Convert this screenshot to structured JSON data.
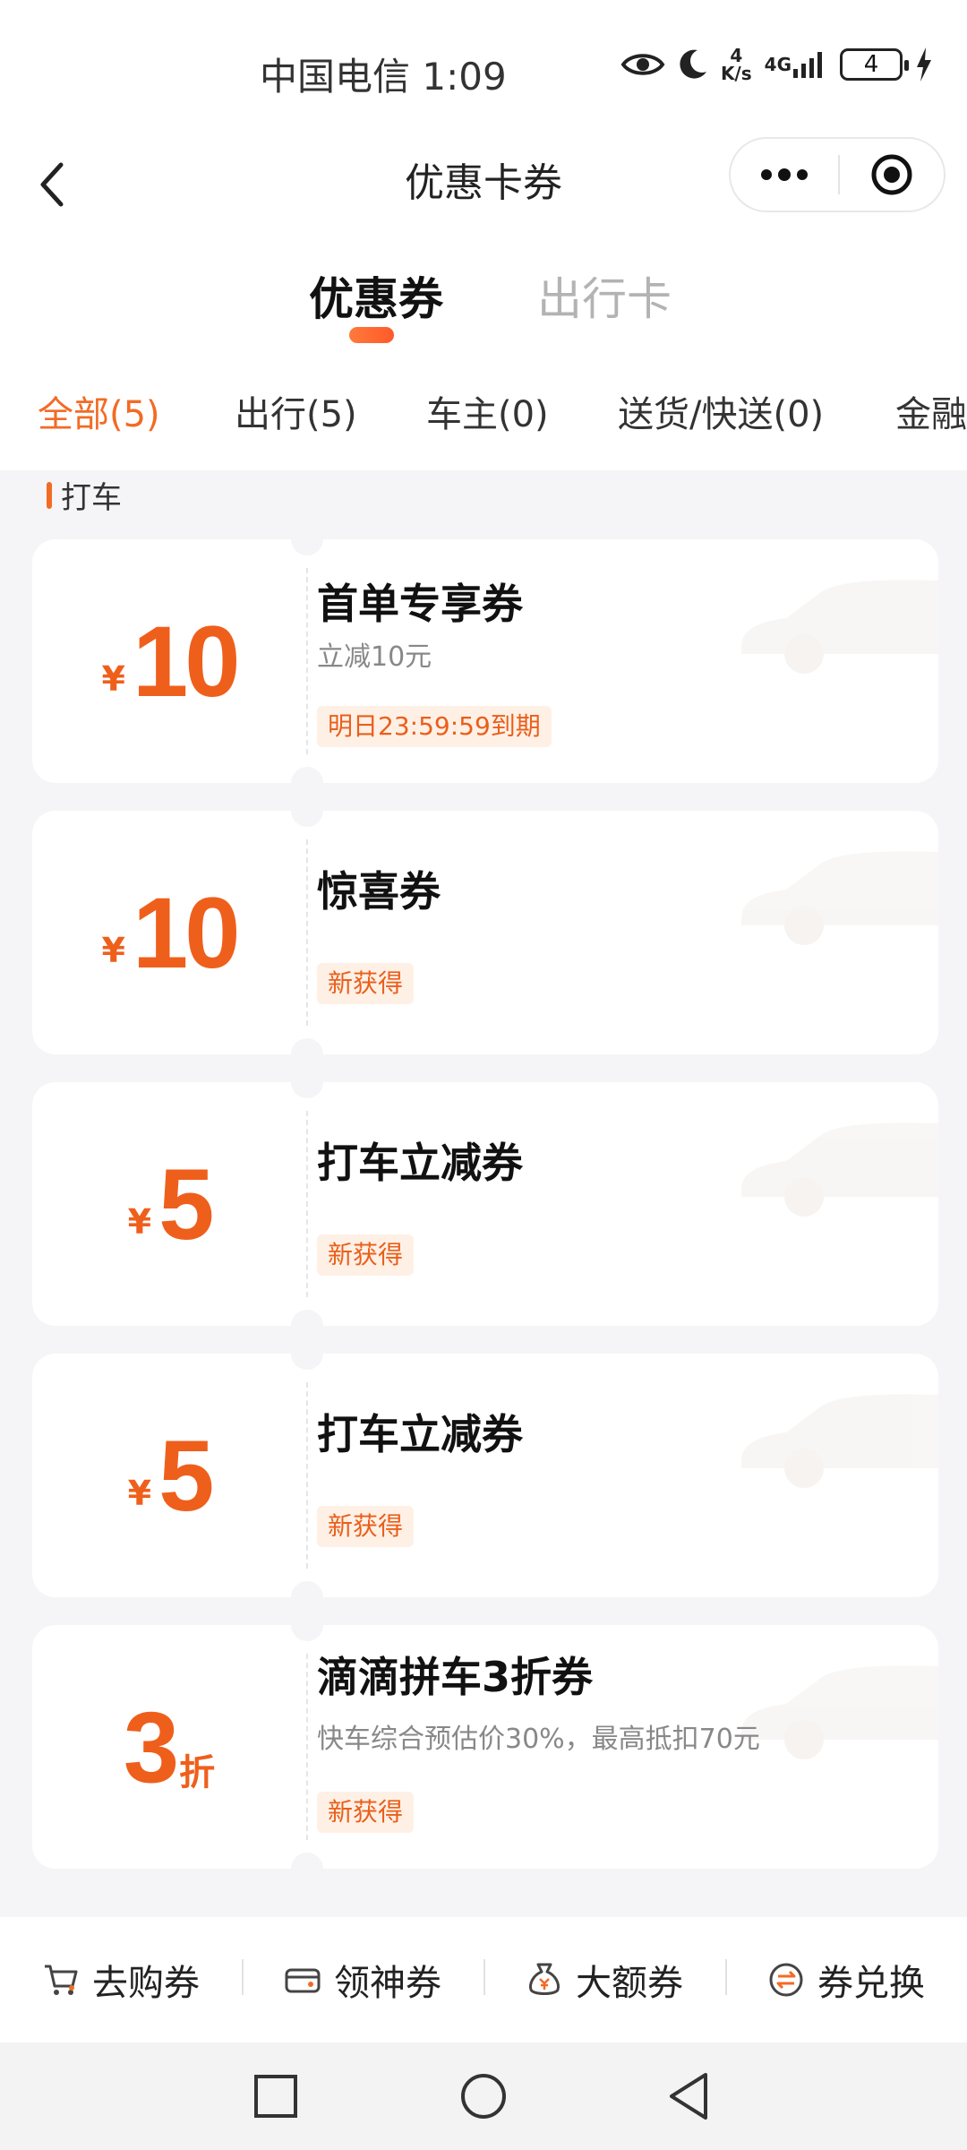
{
  "status_bar": {
    "carrier_time": "中国电信 1:09",
    "net_speed_value": "4",
    "net_speed_unit": "K/s",
    "network": "4G",
    "battery": "4"
  },
  "header": {
    "title": "优惠卡券"
  },
  "main_tabs": [
    {
      "label": "优惠券",
      "active": true
    },
    {
      "label": "出行卡",
      "active": false
    }
  ],
  "sub_tabs": [
    {
      "label": "全部(5)",
      "active": true
    },
    {
      "label": "出行(5)",
      "active": false
    },
    {
      "label": "车主(0)",
      "active": false
    },
    {
      "label": "送货/快送(0)",
      "active": false
    },
    {
      "label": "金融",
      "active": false
    }
  ],
  "section": {
    "title": "打车"
  },
  "coupons": [
    {
      "currency": "¥",
      "amount": "10",
      "unit": "",
      "title": "首单专享券",
      "desc": "立减10元",
      "tag": "明日23:59:59到期"
    },
    {
      "currency": "¥",
      "amount": "10",
      "unit": "",
      "title": "惊喜券",
      "desc": "",
      "tag": "新获得"
    },
    {
      "currency": "¥",
      "amount": "5",
      "unit": "",
      "title": "打车立减券",
      "desc": "",
      "tag": "新获得"
    },
    {
      "currency": "¥",
      "amount": "5",
      "unit": "",
      "title": "打车立减券",
      "desc": "",
      "tag": "新获得"
    },
    {
      "currency": "",
      "amount": "3",
      "unit": "折",
      "title": "滴滴拼车3折券",
      "desc": "快车综合预估价30%，最高抵扣70元",
      "tag": "新获得"
    }
  ],
  "bottom_actions": [
    {
      "label": "去购券",
      "icon": "cart-icon"
    },
    {
      "label": "领神券",
      "icon": "coupon-icon"
    },
    {
      "label": "大额券",
      "icon": "money-bag-icon"
    },
    {
      "label": "券兑换",
      "icon": "exchange-icon"
    }
  ],
  "colors": {
    "accent": "#f26b25",
    "background": "#f5f5f7"
  }
}
